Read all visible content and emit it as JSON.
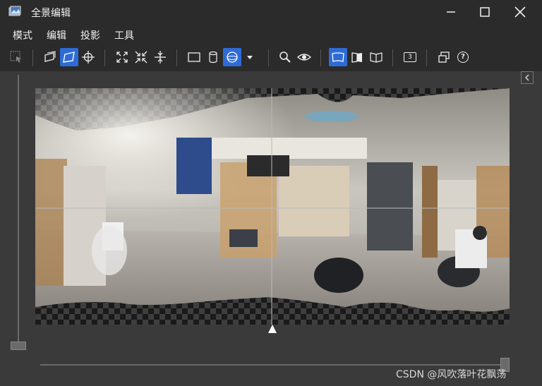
{
  "window": {
    "title": "全景编辑"
  },
  "menu": [
    {
      "label": "模式"
    },
    {
      "label": "编辑"
    },
    {
      "label": "投影"
    },
    {
      "label": "工具"
    }
  ],
  "toolbar": {
    "icons": [
      "select-icon",
      "layers-icon",
      "perspective-icon",
      "crosshair-icon",
      "expand-icon",
      "shrink-icon",
      "center-compress-icon",
      "rectilinear-icon",
      "cylinder-icon",
      "sphere-icon",
      "dropdown-icon",
      "zoom-icon",
      "preview-eye-icon",
      "flat-view-icon",
      "half-view-icon",
      "book-view-icon",
      "number-3-icon",
      "window-icon",
      "help-icon"
    ],
    "number_badge": "3",
    "help_glyph": "?"
  },
  "accent_color": "#2f6bd6",
  "watermark": "CSDN @风吹落叶花飘荡"
}
